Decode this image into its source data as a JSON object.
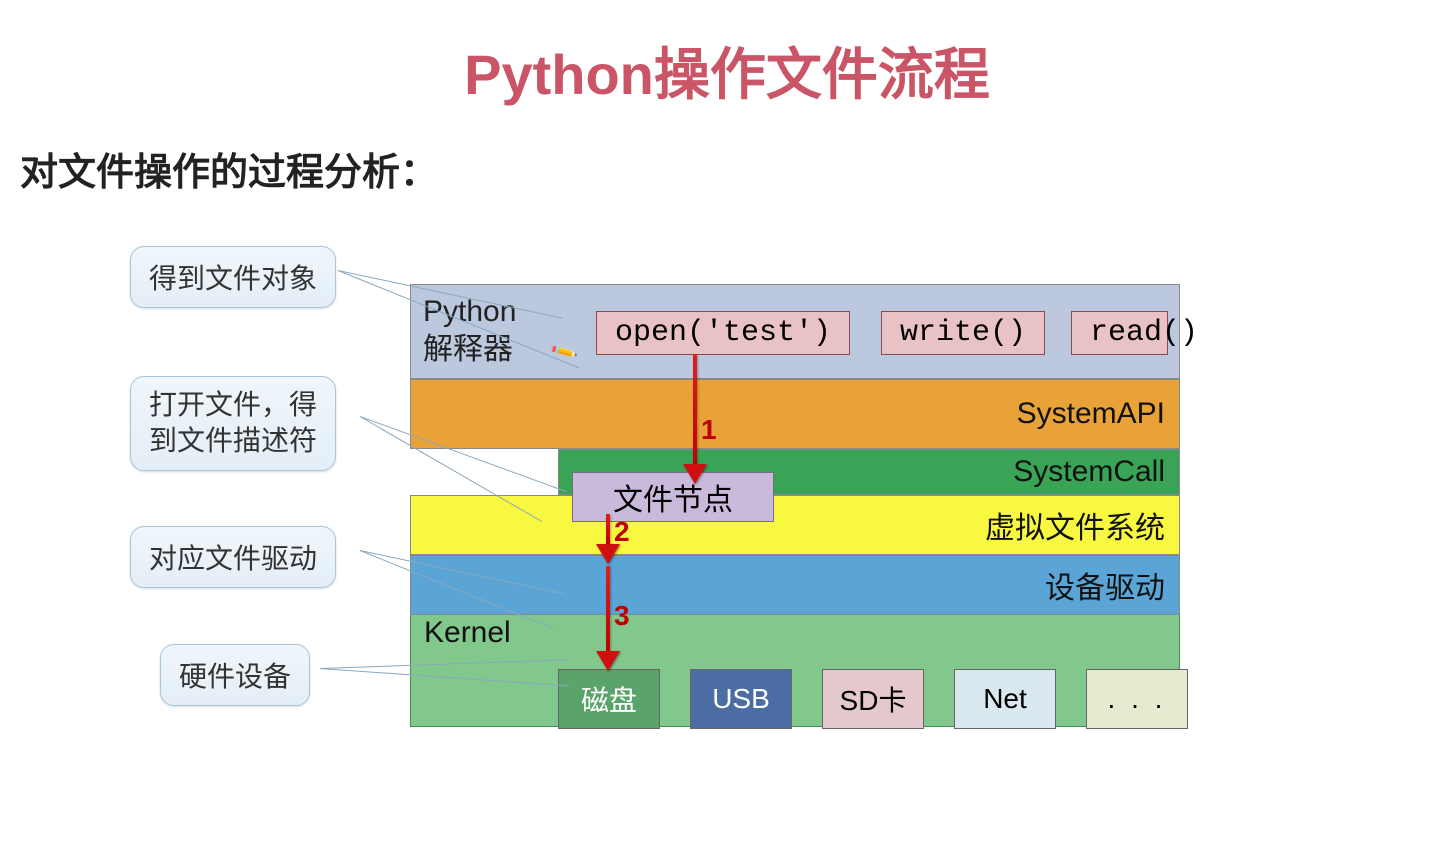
{
  "title": "Python操作文件流程",
  "subtitle": "对文件操作的过程分析：",
  "callouts": {
    "c1": "得到文件对象",
    "c2": "打开文件，得\n到文件描述符",
    "c3": "对应文件驱动",
    "c4": "硬件设备"
  },
  "layers": {
    "python_label": "Python",
    "python_sub": "解释器",
    "fn_open": "open('test')",
    "fn_write": "write()",
    "fn_read": "read()",
    "sysapi": "SystemAPI",
    "syscall": "SystemCall",
    "filenode": "文件节点",
    "vfs": "虚拟文件系统",
    "devdrv": "设备驱动",
    "kernel": "Kernel"
  },
  "hardware": {
    "disk": "磁盘",
    "usb": "USB",
    "sd": "SD卡",
    "net": "Net",
    "more": ". . ."
  },
  "arrow_nums": {
    "n1": "1",
    "n2": "2",
    "n3": "3"
  }
}
